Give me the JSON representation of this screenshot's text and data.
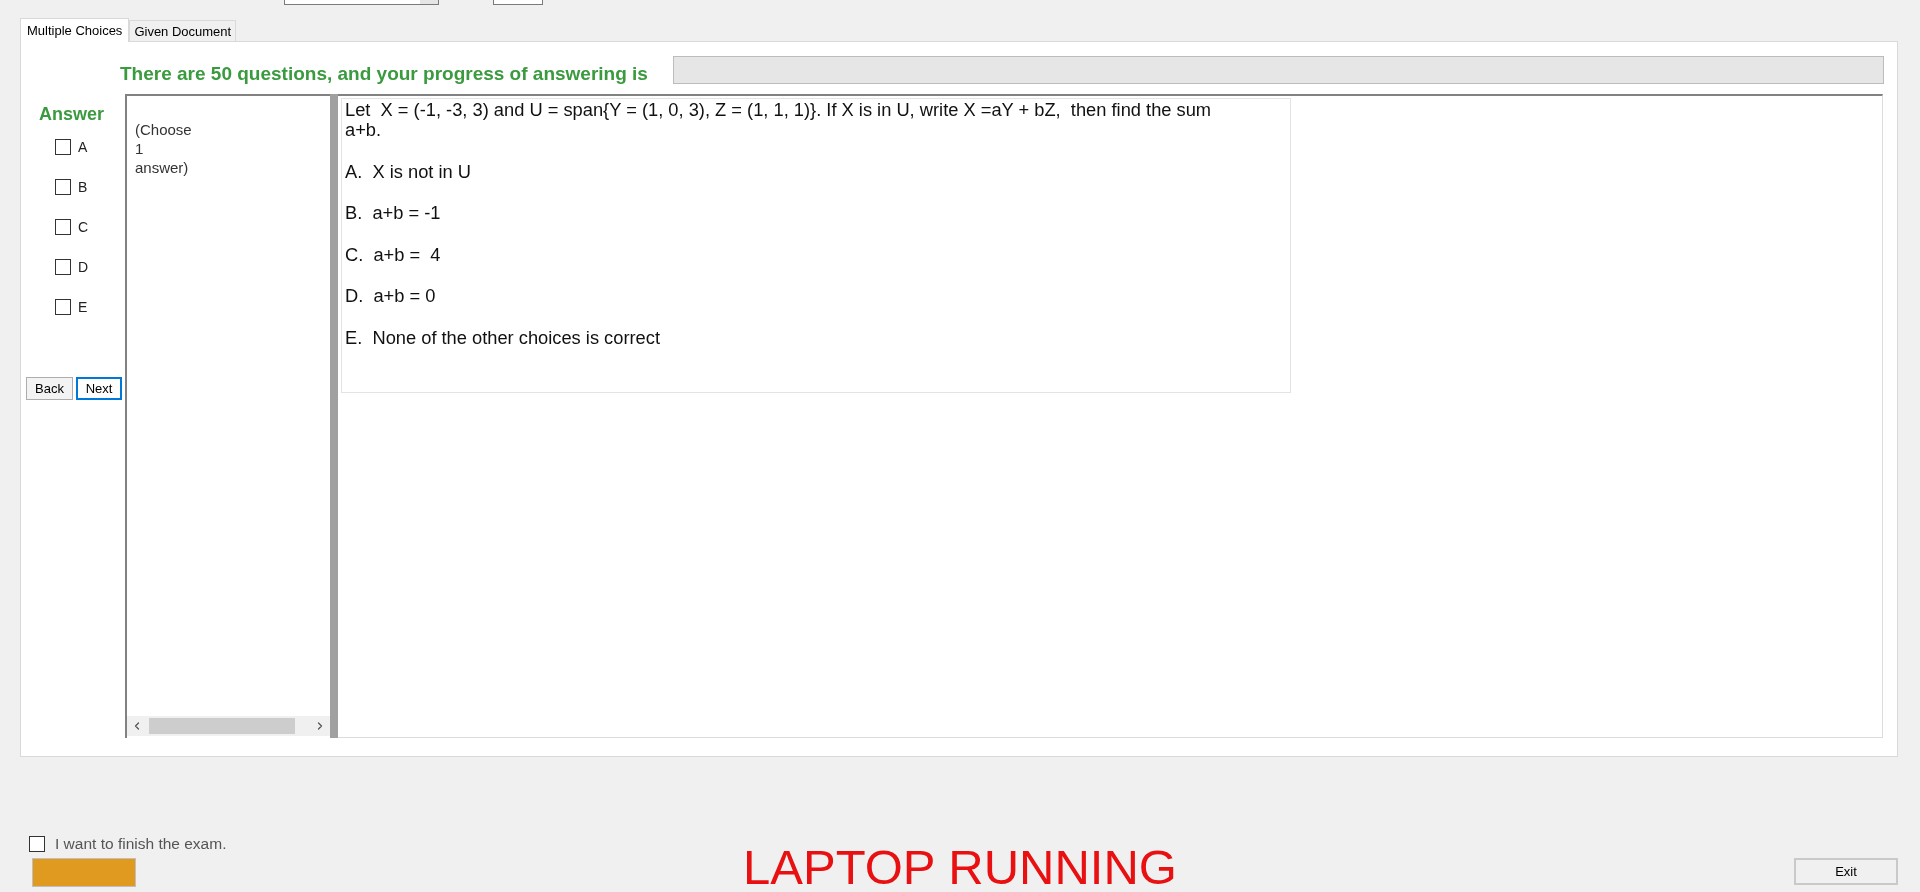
{
  "tabs": [
    {
      "label": "Multiple Choices",
      "selected": true
    },
    {
      "label": "Given Document",
      "selected": false
    }
  ],
  "progress": {
    "label": "There are 50 questions, and your progress of answering is",
    "level": 0
  },
  "answer_panel": {
    "title": "Answer",
    "options": [
      {
        "label": "A",
        "checked": false
      },
      {
        "label": "B",
        "checked": false
      },
      {
        "label": "C",
        "checked": false
      },
      {
        "label": "D",
        "checked": false
      },
      {
        "label": "E",
        "checked": false
      }
    ],
    "buttons": [
      {
        "label": "Back",
        "focused": false
      },
      {
        "label": "Next",
        "focused": true
      }
    ]
  },
  "instruction": "(Choose\n1\nanswer)",
  "question": {
    "text": "Let  X = (-1, -3, 3) and U = span{Y = (1, 0, 3), Z = (1, 1, 1)}. If X is in U, write X =aY + bZ,  then find the sum\na+b.",
    "choices": [
      "A.  X is not in U",
      "B.  a+b = -1",
      "C.  a+b =  4",
      "D.  a+b = 0",
      "E.  None of the other choices is correct"
    ]
  },
  "finish": {
    "label": "I want to finish the exam.",
    "checked": false
  },
  "status_banner": "LAPTOP RUNNING",
  "exit_button": {
    "label": "Exit"
  }
}
